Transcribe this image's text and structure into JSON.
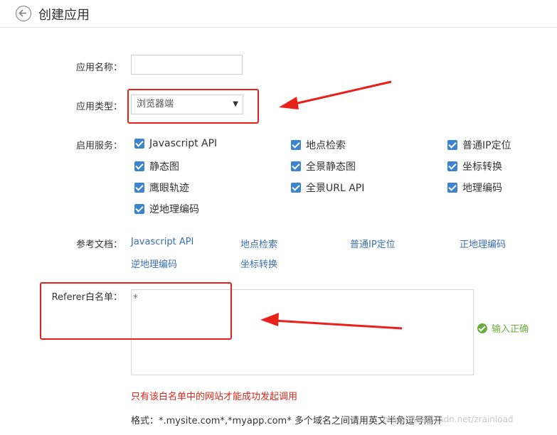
{
  "header": {
    "title": "创建应用"
  },
  "form": {
    "name_label": "应用名称：",
    "type_label": "应用类型：",
    "type_value": "浏览器端",
    "services_label": "启用服务：",
    "services": [
      "Javascript API",
      "地点检索",
      "普通IP定位",
      "静态图",
      "全景静态图",
      "坐标转换",
      "鹰眼轨迹",
      "全景URL API",
      "地理编码",
      "逆地理编码"
    ],
    "docs_label": "参考文档：",
    "docs": [
      "Javascript API",
      "地点检索",
      "普通IP定位",
      "正地理编码",
      "逆地理编码",
      "坐标转换"
    ],
    "referer_label": "Referer白名单：",
    "referer_value": "*",
    "valid_text": "输入正确",
    "whitelist_hint": "只有该白名单中的网站才能成功发起调用",
    "format_hint": "格式：*.mysite.com*,*myapp.com* 多个域名之间请用英文半角逗号隔开"
  },
  "watermark": "https://blog.csdn.net/zrainload",
  "colors": {
    "checkbox": "#3b84d1",
    "link": "#3a6fb0",
    "success": "#6aad3d",
    "error": "#e0251a",
    "annotation": "#e8221a"
  }
}
